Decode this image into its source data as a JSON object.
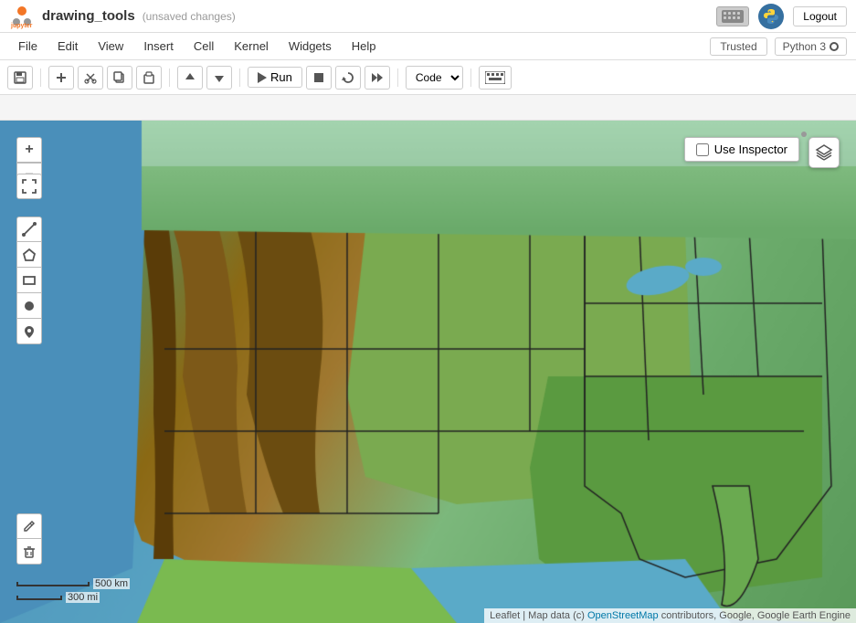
{
  "topbar": {
    "notebook_title": "drawing_tools",
    "unsaved_label": "(unsaved changes)",
    "logout_label": "Logout"
  },
  "menubar": {
    "items": [
      "File",
      "Edit",
      "View",
      "Insert",
      "Cell",
      "Kernel",
      "Widgets",
      "Help"
    ],
    "trusted_label": "Trusted",
    "kernel_label": "Python 3"
  },
  "toolbar": {
    "run_label": "Run",
    "code_option": "Code",
    "buttons": [
      "save",
      "add-cell",
      "cut",
      "copy",
      "paste",
      "move-up",
      "move-down",
      "run",
      "stop",
      "restart",
      "restart-run",
      "fast-forward",
      "keyboard"
    ]
  },
  "map": {
    "use_inspector_label": "Use Inspector",
    "attribution": "Leaflet | Map data (c)",
    "attribution_link": "OpenStreetMap",
    "attribution_rest": " contributors, Google, Google Earth Engine",
    "scale_500": "500 km",
    "scale_300": "300 mi"
  }
}
